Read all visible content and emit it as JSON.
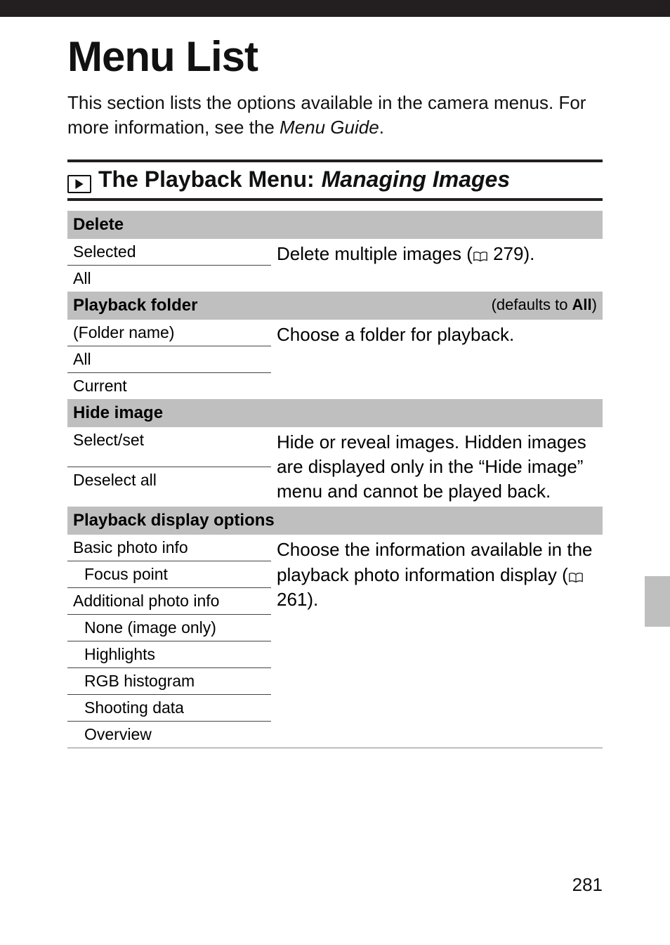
{
  "page": {
    "title": "Menu List",
    "intro_a": "This section lists the options available in the camera menus.  For more information, see the ",
    "intro_b_italic": "Menu Guide",
    "intro_c": ".",
    "number": "281"
  },
  "section": {
    "prefix": "The Playback Menu:",
    "suffix_italic": "Managing Images"
  },
  "groups": {
    "delete": {
      "header": "Delete",
      "opts": {
        "selected": "Selected",
        "all": "All"
      },
      "desc_a": "Delete multiple images (",
      "desc_ref": "279",
      "desc_b": ")."
    },
    "playback_folder": {
      "header": "Playback folder",
      "defaults_pre": "(defaults to ",
      "defaults_val": "All",
      "defaults_post": ")",
      "opts": {
        "foldername": "(Folder name)",
        "all": "All",
        "current": "Current"
      },
      "desc": "Choose a folder for playback."
    },
    "hide_image": {
      "header": "Hide image",
      "opts": {
        "selectset": "Select/set",
        "deselect": "Deselect all"
      },
      "desc": "Hide or reveal images.  Hidden images are displayed only in the “Hide image” menu and cannot be played back."
    },
    "playback_display": {
      "header": "Playback display options",
      "opts": {
        "basic": "Basic photo info",
        "focus": "Focus point",
        "additional": "Additional photo info",
        "none": "None (image only)",
        "highlights": "Highlights",
        "rgb": "RGB histogram",
        "shooting": "Shooting data",
        "overview": "Overview"
      },
      "desc_a": "Choose the information available in the playback photo information display (",
      "desc_ref": "261",
      "desc_b": ")."
    }
  }
}
